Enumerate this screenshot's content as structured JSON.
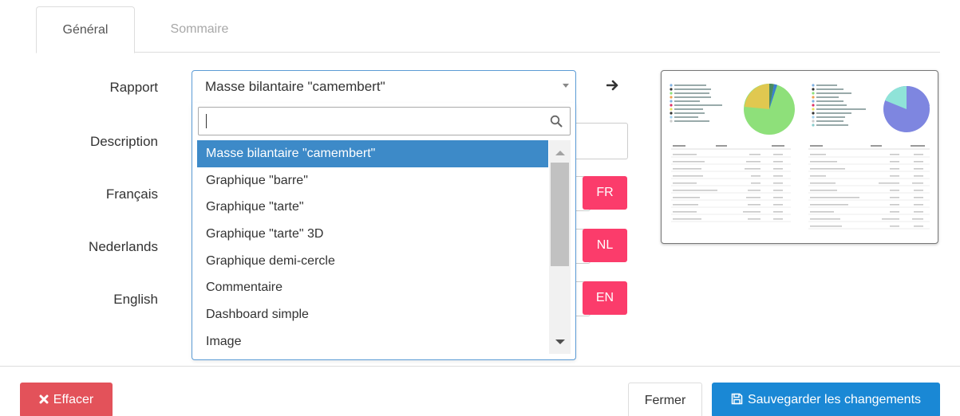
{
  "tabs": [
    {
      "label": "Général",
      "active": true
    },
    {
      "label": "Sommaire",
      "active": false
    }
  ],
  "form": {
    "rapport_label": "Rapport",
    "description_label": "Description",
    "francais_label": "Français",
    "nederlands_label": "Nederlands",
    "english_label": "English",
    "selected_report": "Masse bilantaire \"camembert\"",
    "search_value": "",
    "lang_buttons": {
      "fr": "FR",
      "nl": "NL",
      "en": "EN"
    }
  },
  "dropdown": {
    "options": [
      "Masse bilantaire \"camembert\"",
      "Graphique \"barre\"",
      "Graphique \"tarte\"",
      "Graphique \"tarte\" 3D",
      "Graphique demi-cercle",
      "Commentaire",
      "Dashboard simple",
      "Image"
    ],
    "selected_index": 0
  },
  "footer": {
    "clear_label": "Effacer",
    "close_label": "Fermer",
    "save_label": "Sauvegarder les changements"
  },
  "colors": {
    "accent_blue": "#3d8ac8",
    "lang_pink": "#fb3c6b",
    "clear_red": "#e3525a",
    "save_blue": "#1a88d5"
  },
  "icons": {
    "arrow": "arrow-right-icon",
    "search": "search-icon",
    "clear": "times-icon",
    "save": "floppy-disk-icon"
  }
}
